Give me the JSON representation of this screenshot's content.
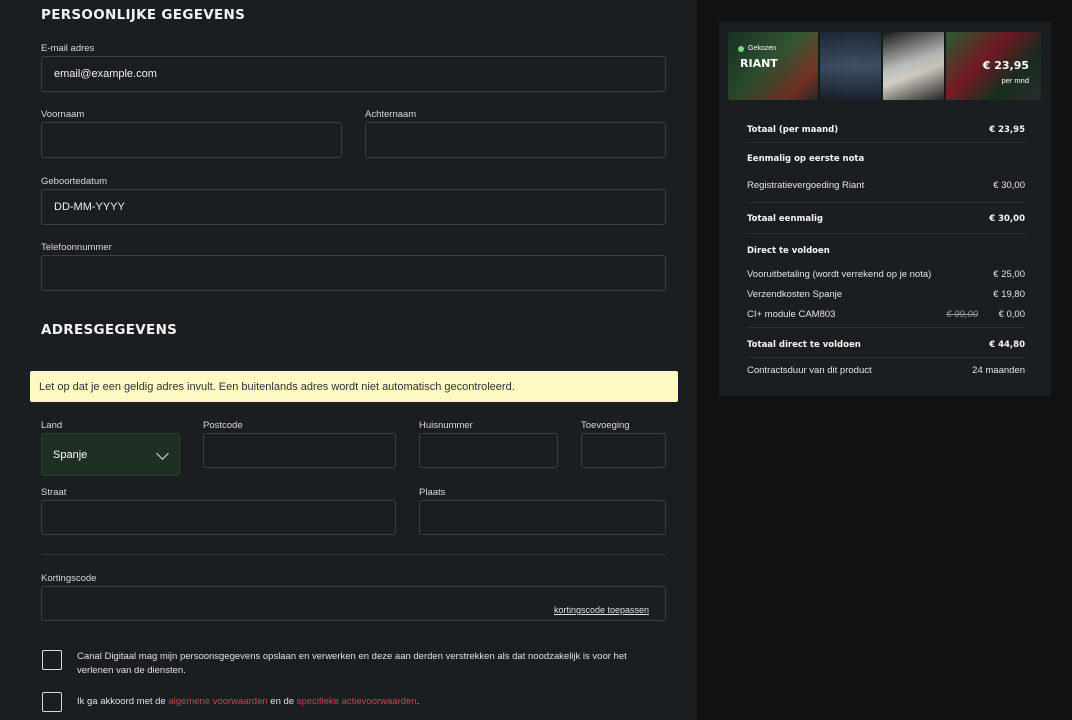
{
  "personal": {
    "title": "PERSOONLIJKE GEGEVENS",
    "email_label": "E-mail adres",
    "email_value": "email@example.com",
    "firstname_label": "Voornaam",
    "lastname_label": "Achternaam",
    "birthdate_label": "Geboortedatum",
    "birthdate_placeholder": "DD-MM-YYYY",
    "phone_label": "Telefoonnummer"
  },
  "address": {
    "title": "ADRESGEGEVENS",
    "notice": "Let op dat je een geldig adres invult. Een buitenlands adres wordt niet automatisch gecontroleerd.",
    "country_label": "Land",
    "country_value": "Spanje",
    "postcode_label": "Postcode",
    "housenumber_label": "Huisnummer",
    "addition_label": "Toevoeging",
    "street_label": "Straat",
    "city_label": "Plaats"
  },
  "discount": {
    "label": "Kortingscode",
    "apply_link": "kortingscode toepassen"
  },
  "consent": {
    "privacy_text": "Canal Digitaal mag mijn persoonsgegevens opslaan en verwerken en deze aan derden verstrekken als dat noodzakelijk is voor het",
    "privacy_text_2": "verlenen van de diensten.",
    "terms_prefix": "Ik ga akkoord met de",
    "terms_link_1": "algemene voorwaarden",
    "terms_middle": "en de",
    "terms_link_2": "specifieke actievoorwaarden",
    "terms_suffix": "."
  },
  "summary": {
    "banner": {
      "chosen": "Gekozen",
      "package": "RIANT",
      "price": "€ 23,95",
      "per": "per mnd"
    },
    "total_month_label": "Totaal (per maand)",
    "total_month_value": "€ 23,95",
    "once_heading": "Eenmalig op eerste nota",
    "registration_label": "Registratievergoeding Riant",
    "registration_value": "€ 30,00",
    "total_once_label": "Totaal eenmalig",
    "total_once_value": "€ 30,00",
    "direct_heading": "Direct te voldoen",
    "prepay_label": "Vooruitbetaling (wordt verrekend op je nota)",
    "prepay_value": "€ 25,00",
    "shipping_label": "Verzendkosten Spanje",
    "shipping_value": "€ 19,80",
    "module_label": "CI+ module CAM803",
    "module_old_value": "€ 99,00",
    "module_value": "€ 0,00",
    "total_direct_label": "Totaal direct te voldoen",
    "total_direct_value": "€ 44,80",
    "contract_label": "Contractsduur van dit product",
    "contract_value": "24 maanden"
  },
  "colors": {
    "panel": "#1b1e21",
    "background": "#111111",
    "notice": "#fef9c3",
    "link": "#d04055",
    "select_bg": "#1f2f23"
  }
}
